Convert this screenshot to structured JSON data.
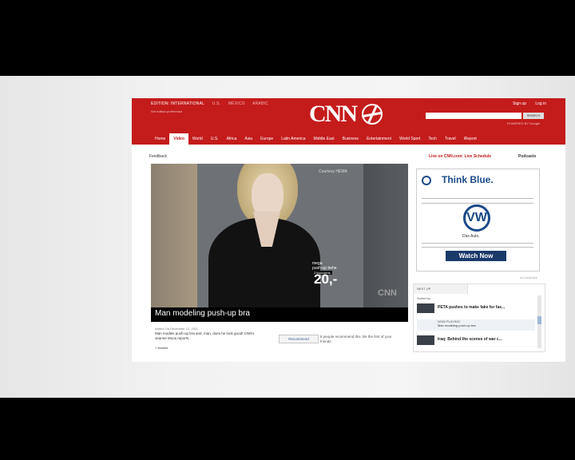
{
  "header": {
    "edition_items": [
      "EDITION: INTERNATIONAL",
      "U.S.",
      "MÉXICO",
      "ARABIC"
    ],
    "set_pref": "Set edition preference",
    "logo_text": "CNN",
    "signin": "Sign up",
    "login": "Log in",
    "search_button": "SEARCH",
    "powered_by": "POWERED BY Google"
  },
  "nav": {
    "items": [
      "Home",
      "Video",
      "World",
      "U.S.",
      "Africa",
      "Asia",
      "Europe",
      "Latin America",
      "Middle East",
      "Business",
      "Entertainment",
      "World Sport",
      "Tech",
      "Travel",
      "iReport"
    ],
    "active": "Video"
  },
  "subbar": {
    "feedback": "Feedback",
    "live": "Live on CNN.com: Live Schedule",
    "podcasts": "Podcasts"
  },
  "video": {
    "courtesy": "Courtesy HEMA",
    "ad_text_1": "mega",
    "ad_text_2": "push-up behe",
    "ad_tag": "2 kopvorms",
    "price": "20,-",
    "bug": "CNN",
    "caption": "Man modeling push-up bra",
    "added": "Added On December 12, 2011",
    "description": "Man models push-up bra and, man, does he look good! CNN's Jeanne Moos reports.",
    "permalink": "+ Iesdofx",
    "recommend": "Recommend",
    "fb_text": "8 people recommend this. Be the first of your friends."
  },
  "ad": {
    "headline": "Think Blue.",
    "logo_letters": "VW",
    "tagline": "Das Auto.",
    "cta": "Watch Now",
    "feedback": "ad feedback"
  },
  "upnext": {
    "tab": "NEXT UP",
    "sub": "Sorted by",
    "items": [
      {
        "title": "PETA pushes to make fake fur fas..."
      },
      {
        "now_label": "NOW PLAYING",
        "title": "Man modeling push-up bra"
      },
      {
        "title": "Iraq: Behind the scenes of war c..."
      }
    ]
  },
  "colors": {
    "cnn_red": "#c41b1b",
    "vw_blue": "#1a4a8a"
  }
}
